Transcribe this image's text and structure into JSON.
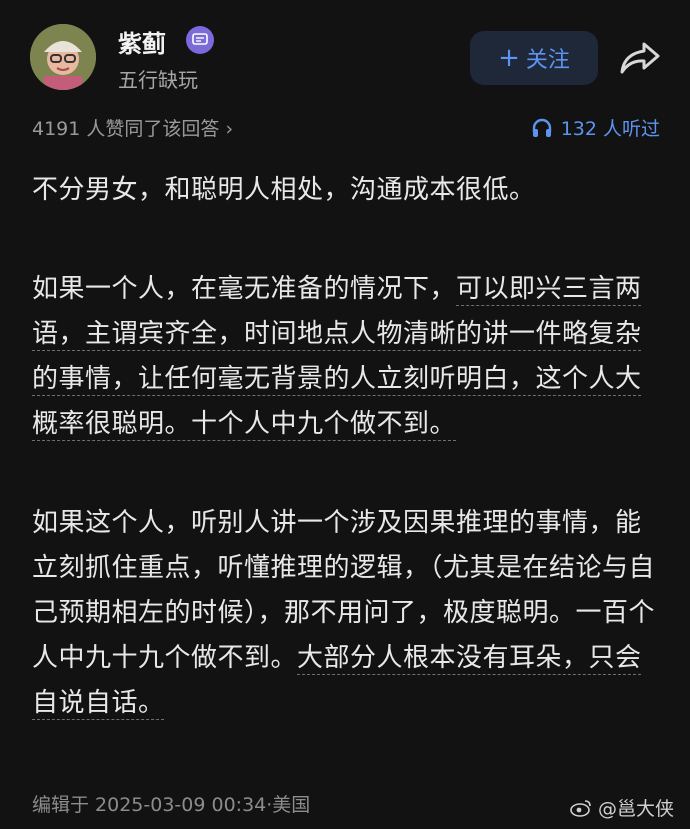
{
  "author": {
    "name": "紫蓟",
    "subtitle": "五行缺玩"
  },
  "header": {
    "follow_label": "关注"
  },
  "stats": {
    "likes_text": "4191 人赞同了该回答",
    "listeners_text": "132 人听过"
  },
  "answer": {
    "p1": "不分男女，和聪明人相处，沟通成本很低。",
    "p2": {
      "plain": "如果一个人，在毫无准备的情况下，",
      "highlight": "可以即兴三言两语，主谓宾齐全，时间地点人物清晰的讲一件略复杂的事情，让任何毫无背景的人立刻听明白，这个人大概率很聪明。十个人中九个做不到。"
    },
    "p3": {
      "plain": "如果这个人，听别人讲一个涉及因果推理的事情，能立刻抓住重点，听懂推理的逻辑，（尤其是在结论与自己预期相左的时候），那不用问了，极度聪明。一百个人中九十九个做不到。",
      "highlight": "大部分人根本没有耳朵，只会自说自话。"
    }
  },
  "footer": {
    "edited_text": "编辑于 2025-03-09 00:34·美国"
  },
  "watermark": {
    "text": "@邕大侠"
  },
  "colors": {
    "background": "#121212",
    "accent_blue": "#5d94f2",
    "badge_purple": "#7b6ad9"
  }
}
